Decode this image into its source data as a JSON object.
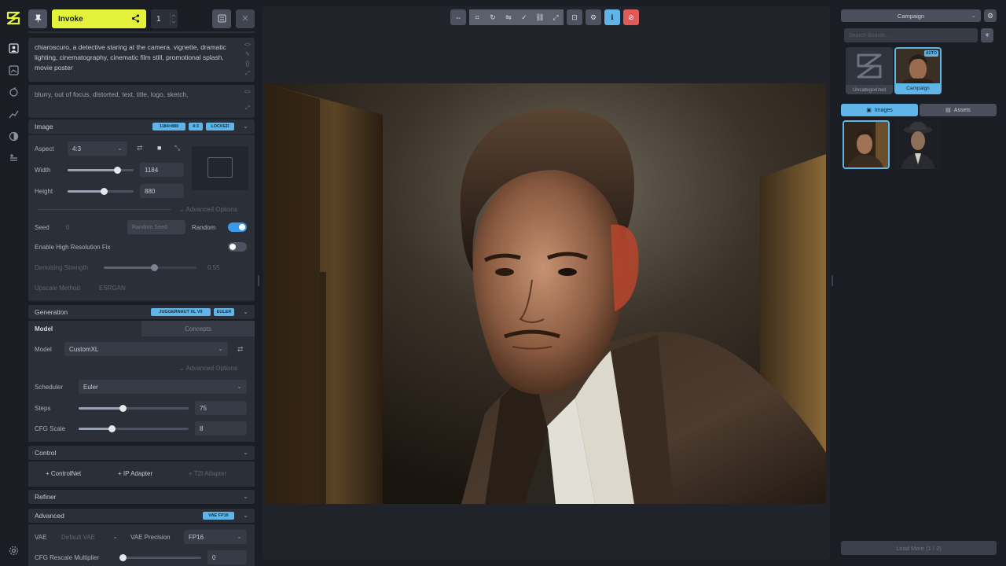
{
  "colors": {
    "accent_yellow": "#e3f33a",
    "accent_blue": "#5fb5e8",
    "toggle_on": "#3b9ae8",
    "panel_bg": "#22262e",
    "app_bg": "#1a1d24",
    "red_button": "#e05a5a"
  },
  "rail": {
    "icons": [
      "logo-icon",
      "image-icon",
      "canvas-icon",
      "workflow-icon",
      "model-icon",
      "queue-icon",
      "layers-icon",
      "settings-icon"
    ]
  },
  "topbar": {
    "invoke_label": "Invoke",
    "iterations": "1"
  },
  "prompts": {
    "positive": "chiaroscuro, a detective staring at the camera. vignette, dramatic lighting, cinematography, cinematic film still, promotional splash, movie poster",
    "negative": "blurry, out of focus, distorted, text, title, logo, sketch,"
  },
  "image_section": {
    "title": "Image",
    "badges": [
      "1184×880",
      "4:3",
      "LOCKED"
    ],
    "aspect_label": "Aspect",
    "aspect_value": "4:3",
    "width_label": "Width",
    "width_value": "1184",
    "height_label": "Height",
    "height_value": "880",
    "width_level": 0.75,
    "height_level": 0.55,
    "advanced_options": "Advanced Options",
    "seed_label": "Seed",
    "seed_value": "0",
    "random_seed_button": "Random Seed",
    "random_label": "Random",
    "random_on": true,
    "hrf_label": "Enable High Resolution Fix",
    "hrf_on": false,
    "denoise_label": "Denoising Strength",
    "denoise_value": "0.55",
    "denoise_level": 0.55,
    "upscale_label": "Upscale Method",
    "upscale_value": "ESRGAN"
  },
  "generation_section": {
    "title": "Generation",
    "badges": [
      "JUGGERNAUT XL V9",
      "EULER"
    ],
    "tab_model": "Model",
    "tab_concepts": "Concepts",
    "model_label": "Model",
    "model_value": "CustomXL",
    "advanced_options": "Advanced Options",
    "scheduler_label": "Scheduler",
    "scheduler_value": "Euler",
    "steps_label": "Steps",
    "steps_value": "75",
    "steps_level": 0.4,
    "cfg_label": "CFG Scale",
    "cfg_value": "8",
    "cfg_level": 0.3
  },
  "control_section": {
    "title": "Control",
    "controlnet": "+ ControlNet",
    "ip_adapter": "+ IP Adapter",
    "t2i_adapter": "+ T2I Adapter"
  },
  "refiner_section": {
    "title": "Refiner"
  },
  "advanced_section": {
    "title": "Advanced",
    "badge": "VAE FP16",
    "vae_label": "VAE",
    "vae_value": "Default VAE",
    "vae_precision_label": "VAE Precision",
    "vae_precision_value": "FP16",
    "cfg_rescale_label": "CFG Rescale Multiplier",
    "cfg_rescale_value": "0"
  },
  "canvas_toolbar": {
    "buttons": [
      "compare-icon",
      "crop-icon",
      "rotate-icon",
      "flip-icon",
      "check-icon",
      "link-icon",
      "expand-icon",
      "save-icon",
      "gear-icon",
      "info-icon",
      "delete-icon"
    ]
  },
  "gallery": {
    "board_select": "Campaign",
    "search_placeholder": "Search Boards...",
    "boards": [
      {
        "label": "Uncategorized"
      },
      {
        "label": "Campaign",
        "badge": "AUTO"
      }
    ],
    "tab_images": "Images",
    "tab_assets": "Assets",
    "load_more": "Load More (1 / 2)"
  }
}
